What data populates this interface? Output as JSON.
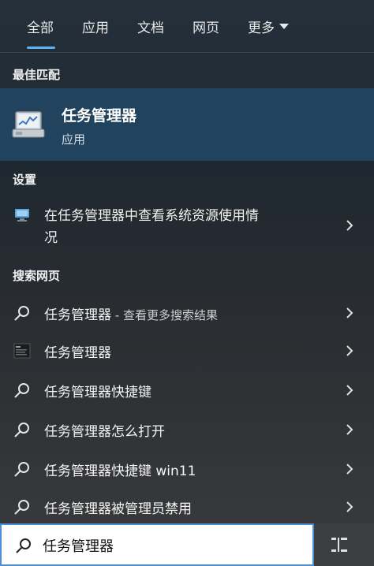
{
  "tabs": [
    {
      "label": "全部"
    },
    {
      "label": "应用"
    },
    {
      "label": "文档"
    },
    {
      "label": "网页"
    },
    {
      "label": "更多"
    }
  ],
  "sections": {
    "best_match": "最佳匹配",
    "settings": "设置",
    "web": "搜索网页"
  },
  "best_match": {
    "title": "任务管理器",
    "subtitle": "应用",
    "icon": "task-manager-icon"
  },
  "settings_item": {
    "line1": "在任务管理器中查看系统资源使用情",
    "line2": "况"
  },
  "web_items": [
    {
      "text": "任务管理器",
      "suffix": " - 查看更多搜索结果",
      "icon": "search-icon"
    },
    {
      "text": "任务管理器",
      "suffix": "",
      "icon": "web-thumbnail-icon"
    },
    {
      "text": "任务管理器快捷键",
      "suffix": "",
      "icon": "search-icon"
    },
    {
      "text": "任务管理器怎么打开",
      "suffix": "",
      "icon": "search-icon"
    },
    {
      "text": "任务管理器快捷键 win11",
      "suffix": "",
      "icon": "search-icon"
    },
    {
      "text": "任务管理器被管理员禁用",
      "suffix": "",
      "icon": "search-icon"
    }
  ],
  "search": {
    "value": "任务管理器"
  },
  "colors": {
    "accent": "#5fb2f2",
    "selected_bg": "#21435d"
  }
}
